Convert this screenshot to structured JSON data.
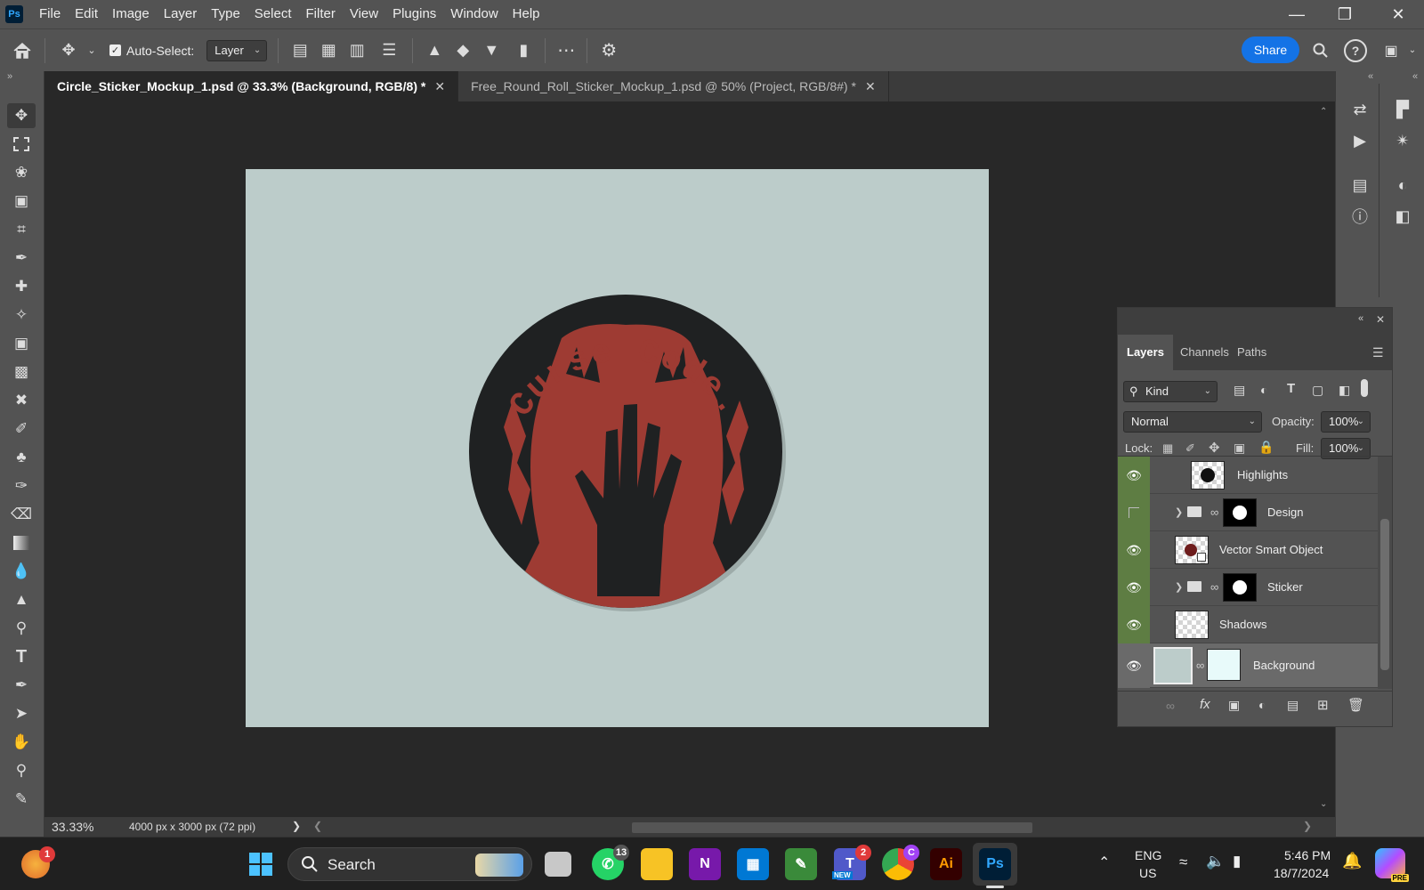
{
  "app": {
    "logo": "Ps"
  },
  "menu": [
    "File",
    "Edit",
    "Image",
    "Layer",
    "Type",
    "Select",
    "Filter",
    "View",
    "Plugins",
    "Window",
    "Help"
  ],
  "options_bar": {
    "auto_select_label": "Auto-Select:",
    "auto_select_checked": true,
    "auto_select_target": "Layer",
    "share_label": "Share"
  },
  "tabs": [
    {
      "label": "Circle_Sticker_Mockup_1.psd @ 33.3% (Background, RGB/8) *",
      "active": true
    },
    {
      "label": "Free_Round_Roll_Sticker_Mockup_1.psd @ 50% (Project, RGB/8#) *",
      "active": false
    }
  ],
  "canvas": {
    "background_color": "#bcccca",
    "sticker_text": "Curse Code.",
    "sticker_colors": {
      "dark": "#1f2122",
      "red": "#9e3b33"
    }
  },
  "layers_panel": {
    "tabs": [
      "Layers",
      "Channels",
      "Paths"
    ],
    "filter_kind": "Kind",
    "blend_mode": "Normal",
    "opacity_label": "Opacity:",
    "opacity_value": "100%",
    "lock_label": "Lock:",
    "fill_label": "Fill:",
    "fill_value": "100%",
    "layers": [
      {
        "name": "Highlights",
        "visible": true,
        "type": "layer"
      },
      {
        "name": "Design",
        "visible": false,
        "type": "group"
      },
      {
        "name": "Vector Smart Object",
        "visible": true,
        "type": "smart"
      },
      {
        "name": "Sticker",
        "visible": true,
        "type": "group"
      },
      {
        "name": "Shadows",
        "visible": true,
        "type": "layer"
      },
      {
        "name": "Background",
        "visible": true,
        "type": "background",
        "selected": true
      }
    ]
  },
  "status": {
    "zoom": "33.33%",
    "doc_info": "4000 px x 3000 px (72 ppi)"
  },
  "taskbar": {
    "search_label": "Search",
    "whatsapp_badge": "13",
    "teams_badge": "2",
    "teams_new": "NEW",
    "chrome_profile": "C",
    "illustrator": "Ai",
    "photoshop": "Ps",
    "copilot_pre": "PRE",
    "widget_badge": "1",
    "lang_top": "ENG",
    "lang_bottom": "US",
    "time": "5:46 PM",
    "date": "18/7/2024"
  }
}
